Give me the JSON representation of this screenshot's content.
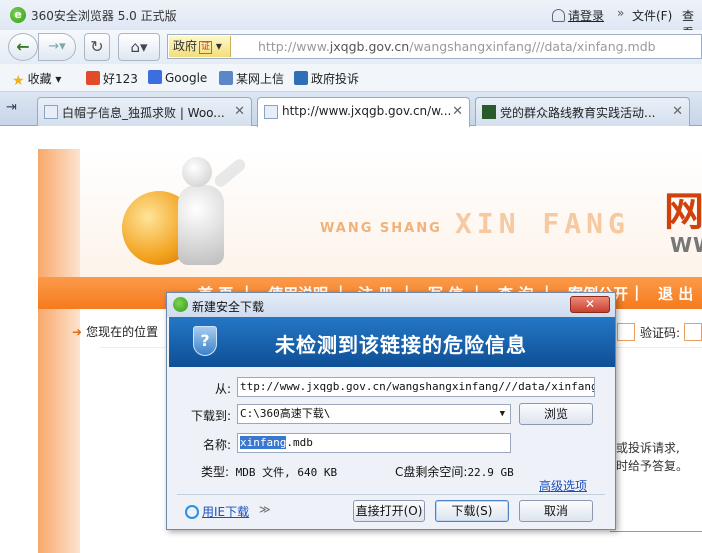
{
  "browser": {
    "title": "360安全浏览器 5.0 正式版",
    "login_label": "请登录",
    "more": "»",
    "menu_file": "文件(F)",
    "menu_view": "查看",
    "gov_label": "政府",
    "gov_cert": "证",
    "address_prefix": "http://www.",
    "address_domain": "jxqgb.gov.cn",
    "address_path": "/wangshangxinfang///data/xinfang.mdb"
  },
  "favorites": [
    {
      "label": "收藏",
      "icon": "star-icon",
      "color": "#f2b01e"
    },
    {
      "label": "好123",
      "icon": "hao123-icon",
      "color": "#e24a2a"
    },
    {
      "label": "Google",
      "icon": "google-icon",
      "color": "#3b6fe0"
    },
    {
      "label": "某网上信",
      "icon": "site-icon",
      "color": "#5b87c9"
    },
    {
      "label": "政府投诉",
      "icon": "edit-icon",
      "color": "#2f6fb8"
    }
  ],
  "tabs": [
    {
      "label": "白帽子信息_独孤求败 | Woo...",
      "icon": "ie-page-icon"
    },
    {
      "label": "http://www.jxqgb.gov.cn/w...",
      "icon": "ie-page-icon"
    },
    {
      "label": "党的群众路线教育实践活动...",
      "icon": "party-icon"
    }
  ],
  "site": {
    "tag_small": "WANG SHANG",
    "tag_big": "XIN FANG",
    "logo_char": "网",
    "logo_sub": "WW",
    "menu": [
      "首 页",
      "|",
      "使用说明",
      "|",
      "注 册",
      "|",
      "写 信",
      "|",
      "查 询",
      "|",
      "案例公开",
      "|",
      "退 出"
    ],
    "crumb": "您现在的位置",
    "captcha_label": "验证码:",
    "side_text_1": "或投诉请求,",
    "side_text_2": "时给予答复。"
  },
  "dialog": {
    "title": "新建安全下载",
    "close": "✕",
    "banner": "未检测到该链接的危险信息",
    "from_label": "从:",
    "from_value": "ttp://www.jxqgb.gov.cn/wangshangxinfang///data/xinfang.mdb",
    "saveto_label": "下载到:",
    "saveto_value": "C:\\360高速下载\\",
    "browse": "浏览",
    "name_label": "名称:",
    "name_selected": "xinfang",
    "name_rest": ".mdb",
    "type_label": "类型:",
    "type_value": "MDB 文件, 640 KB",
    "space_label": "C盘剩余空间:",
    "space_value": "22.9 GB",
    "advanced": "高级选项",
    "ie_download": "用IE下载",
    "chevron": "≫",
    "open_direct": "直接打开(O)",
    "download": "下载(S)",
    "cancel": "取消"
  }
}
